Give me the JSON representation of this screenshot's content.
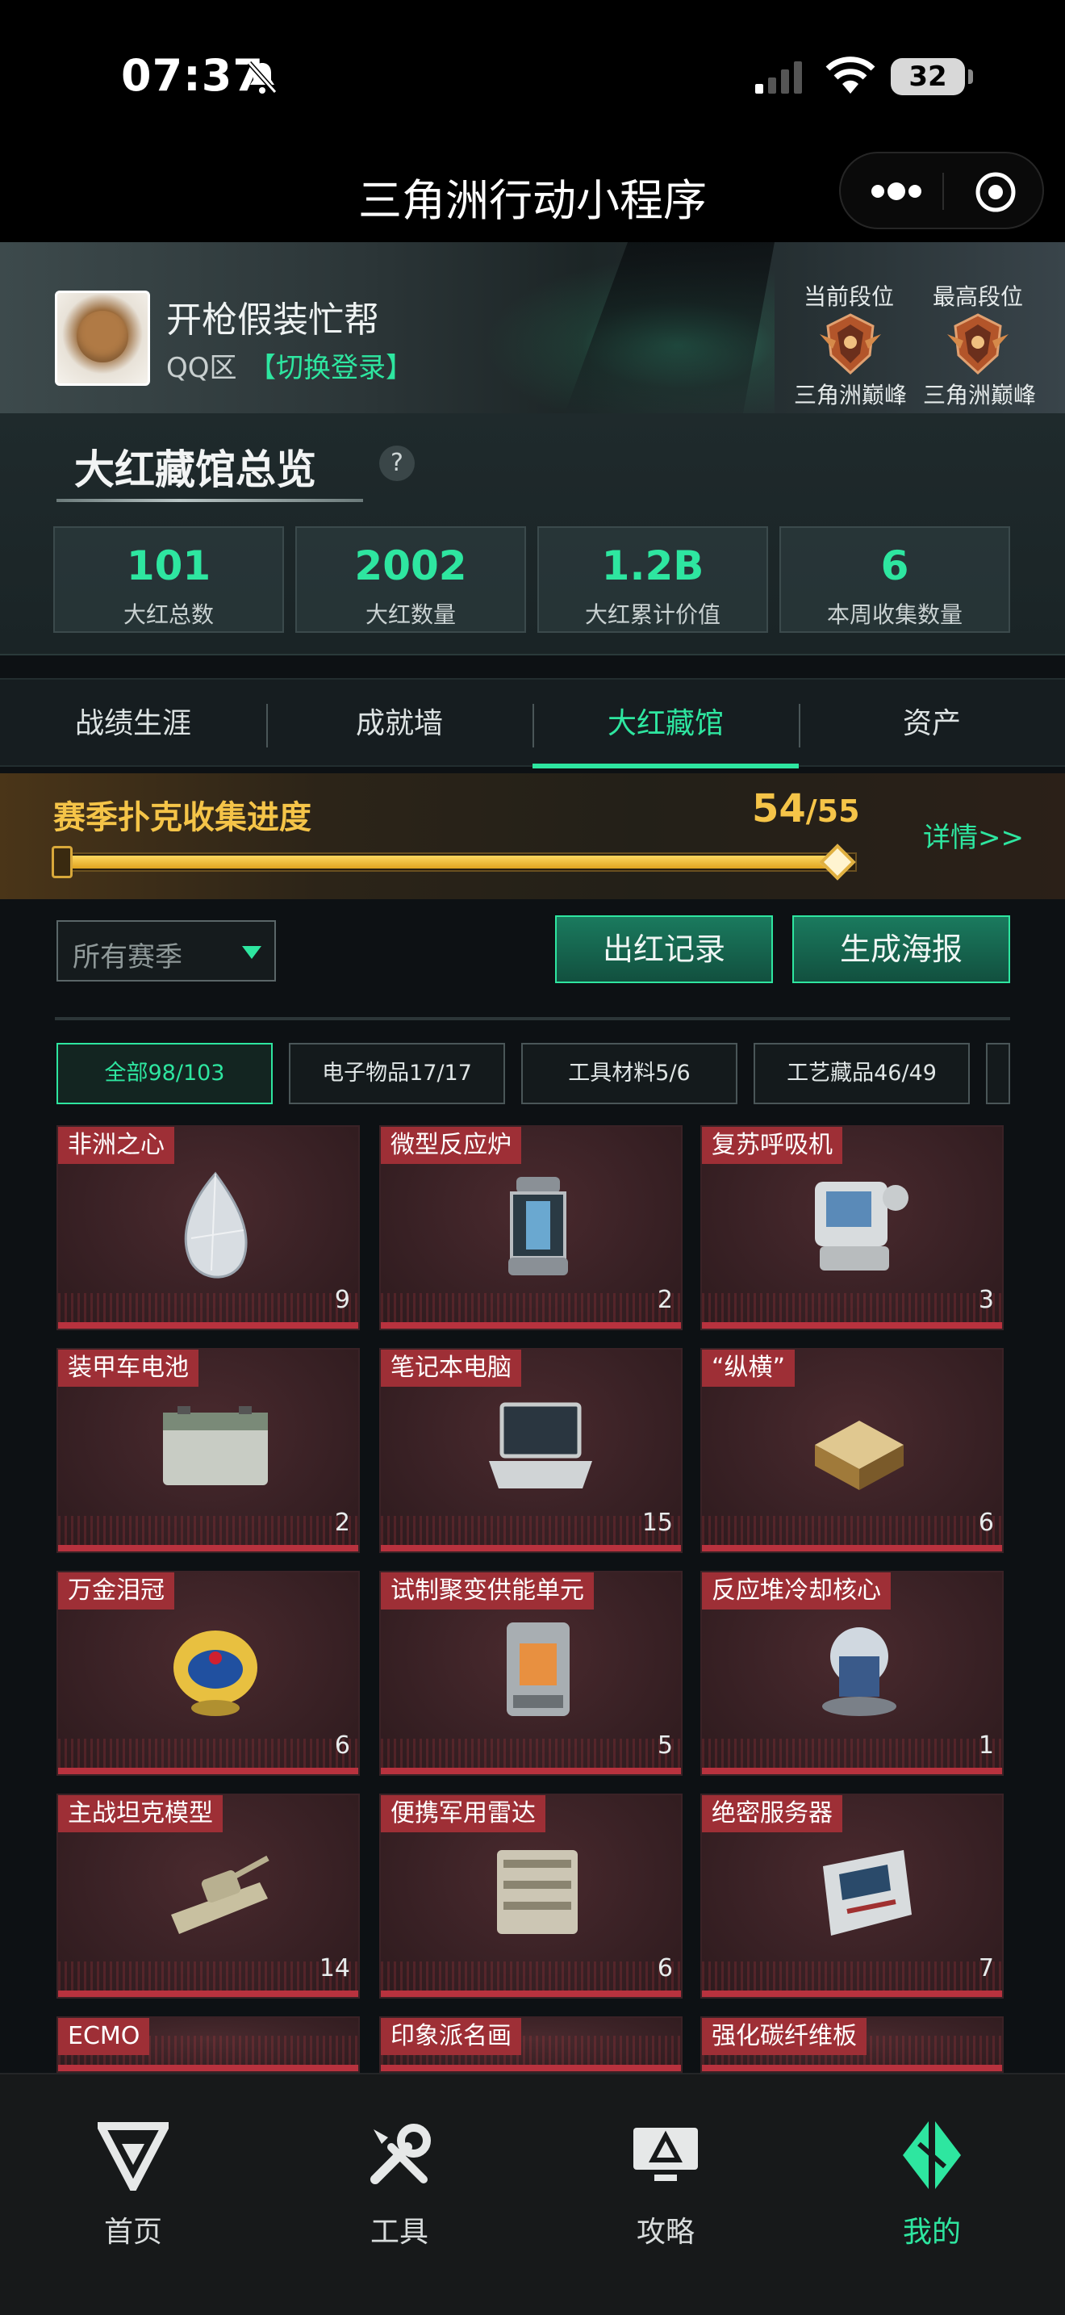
{
  "status_bar": {
    "time": "07:37",
    "battery": "32"
  },
  "title_bar": {
    "title": "三角洲行动小程序"
  },
  "profile": {
    "username": "开枪假装忙帮",
    "zone": "QQ区",
    "switch_login": "【切换登录】",
    "current_rank_label": "当前段位",
    "current_rank_name": "三角洲巅峰",
    "highest_rank_label": "最高段位",
    "highest_rank_name": "三角洲巅峰"
  },
  "overview": {
    "title": "大红藏馆总览",
    "help": "?",
    "stats": [
      {
        "value": "101",
        "label": "大红总数"
      },
      {
        "value": "2002",
        "label": "大红数量"
      },
      {
        "value": "1.2B",
        "label": "大红累计价值"
      },
      {
        "value": "6",
        "label": "本周收集数量"
      }
    ]
  },
  "tabs": [
    {
      "label": "战绩生涯"
    },
    {
      "label": "成就墙"
    },
    {
      "label": "大红藏馆"
    },
    {
      "label": "资产"
    }
  ],
  "poker": {
    "title": "赛季扑克收集进度",
    "collected": "54",
    "total": "/55",
    "fraction": 0.98,
    "details": "详情>>"
  },
  "filters": {
    "season_placeholder": "所有赛季",
    "record_button": "出红记录",
    "poster_button": "生成海报",
    "categories": [
      {
        "label": "全部98/103"
      },
      {
        "label": "电子物品17/17"
      },
      {
        "label": "工具材料5/6"
      },
      {
        "label": "工艺藏品46/49"
      }
    ]
  },
  "items": [
    {
      "name": "非洲之心",
      "count": "9",
      "icon": "diamond-icon"
    },
    {
      "name": "微型反应炉",
      "count": "2",
      "icon": "reactor-icon"
    },
    {
      "name": "复苏呼吸机",
      "count": "3",
      "icon": "ventilator-icon"
    },
    {
      "name": "装甲车电池",
      "count": "2",
      "icon": "battery-icon"
    },
    {
      "name": "笔记本电脑",
      "count": "15",
      "icon": "laptop-icon"
    },
    {
      "name": "“纵横”",
      "count": "6",
      "icon": "chessboard-icon"
    },
    {
      "name": "万金泪冠",
      "count": "6",
      "icon": "jewel-egg-icon"
    },
    {
      "name": "试制聚变供能单元",
      "count": "5",
      "icon": "fusion-unit-icon"
    },
    {
      "name": "反应堆冷却核心",
      "count": "1",
      "icon": "cooling-core-icon"
    },
    {
      "name": "主战坦克模型",
      "count": "14",
      "icon": "tank-model-icon"
    },
    {
      "name": "便携军用雷达",
      "count": "6",
      "icon": "radar-icon"
    },
    {
      "name": "绝密服务器",
      "count": "7",
      "icon": "server-icon"
    },
    {
      "name": "ECMO",
      "count": "",
      "icon": "ecmo-icon"
    },
    {
      "name": "印象派名画",
      "count": "",
      "icon": "painting-icon"
    },
    {
      "name": "强化碳纤维板",
      "count": "",
      "icon": "carbon-plate-icon"
    }
  ],
  "bottom_nav": [
    {
      "label": "首页",
      "icon": "home-logo-icon"
    },
    {
      "label": "工具",
      "icon": "tools-icon"
    },
    {
      "label": "攻略",
      "icon": "guide-monitor-icon"
    },
    {
      "label": "我的",
      "icon": "profile-logo-icon"
    }
  ],
  "colors": {
    "accent": "#2ee6a0",
    "gold": "#f5c448",
    "item_red": "#9e2f36"
  }
}
